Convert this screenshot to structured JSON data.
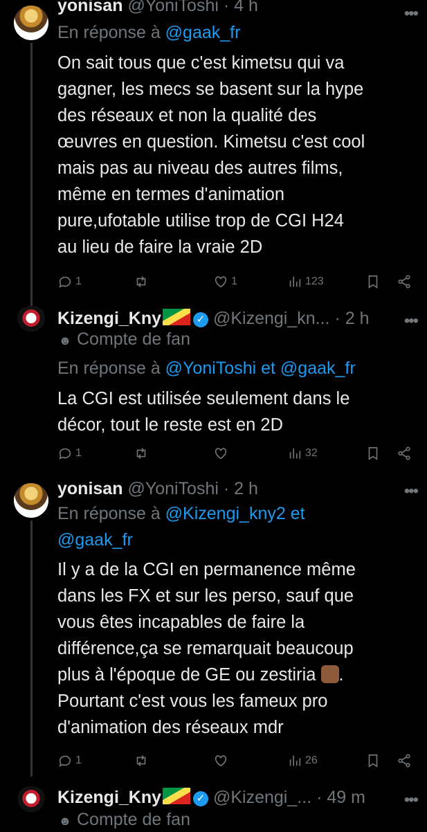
{
  "tweets": [
    {
      "name": "yonisan",
      "handle": "@YoniToshi",
      "sep": "·",
      "time": "4 h",
      "reply_prefix": "En réponse à",
      "reply_to_1": "@gaak_fr",
      "reply_and": "",
      "reply_to_2": "",
      "text": "On sait tous que c'est kimetsu qui va\ngagner, les mecs se basent sur la hype\ndes réseaux et non la qualité des\nœuvres en question. Kimetsu c'est cool\nmais pas au niveau des autres films,\nmême en termes d'animation\npure,ufotable utilise trop de CGI H24\nau lieu de faire la vraie 2D",
      "replies": "1",
      "retweets": "",
      "likes": "1",
      "views": "123"
    },
    {
      "name": "Kizengi_Kny",
      "handle": "@Kizengi_kn...",
      "sep": "·",
      "time": "2 h",
      "fan_label": "Compte de fan",
      "reply_prefix": "En réponse à",
      "reply_to_1": "@YoniToshi",
      "reply_and": "et",
      "reply_to_2": "@gaak_fr",
      "text": "La CGI est utilisée seulement dans le\ndécor, tout le reste est en 2D",
      "replies": "1",
      "retweets": "",
      "likes": "",
      "views": "32"
    },
    {
      "name": "yonisan",
      "handle": "@YoniToshi",
      "sep": "·",
      "time": "2 h",
      "reply_prefix": "En réponse à",
      "reply_to_1": "@Kizengi_kny2",
      "reply_and": "et",
      "reply_to_2": "@gaak_fr",
      "text_a": "Il y a de la CGI en permanence même\ndans les FX et sur les perso, sauf que\nvous êtes incapables de faire la\ndifférence,ça se remarquait beaucoup\nplus à l'époque de GE ou zestiria",
      "text_b": ".\nPourtant c'est vous les fameux pro\nd'animation des réseaux mdr",
      "replies": "1",
      "retweets": "",
      "likes": "",
      "views": "26"
    },
    {
      "name": "Kizengi_Kny",
      "handle": "@Kizengi_...",
      "sep": "·",
      "time": "49 m",
      "fan_label": "Compte de fan"
    }
  ],
  "icons": {
    "reply": "reply-icon",
    "retweet": "retweet-icon",
    "like": "heart-icon",
    "views": "views-icon",
    "bookmark": "bookmark-icon",
    "share": "share-icon",
    "more": "more-icon",
    "verified": "verified-badge-icon",
    "flag": "congo-flag-icon",
    "fan": "theater-mask-icon"
  },
  "colors": {
    "background": "#000000",
    "text": "#e7e9ea",
    "secondary": "#71767b",
    "link": "#1d9bf0"
  }
}
